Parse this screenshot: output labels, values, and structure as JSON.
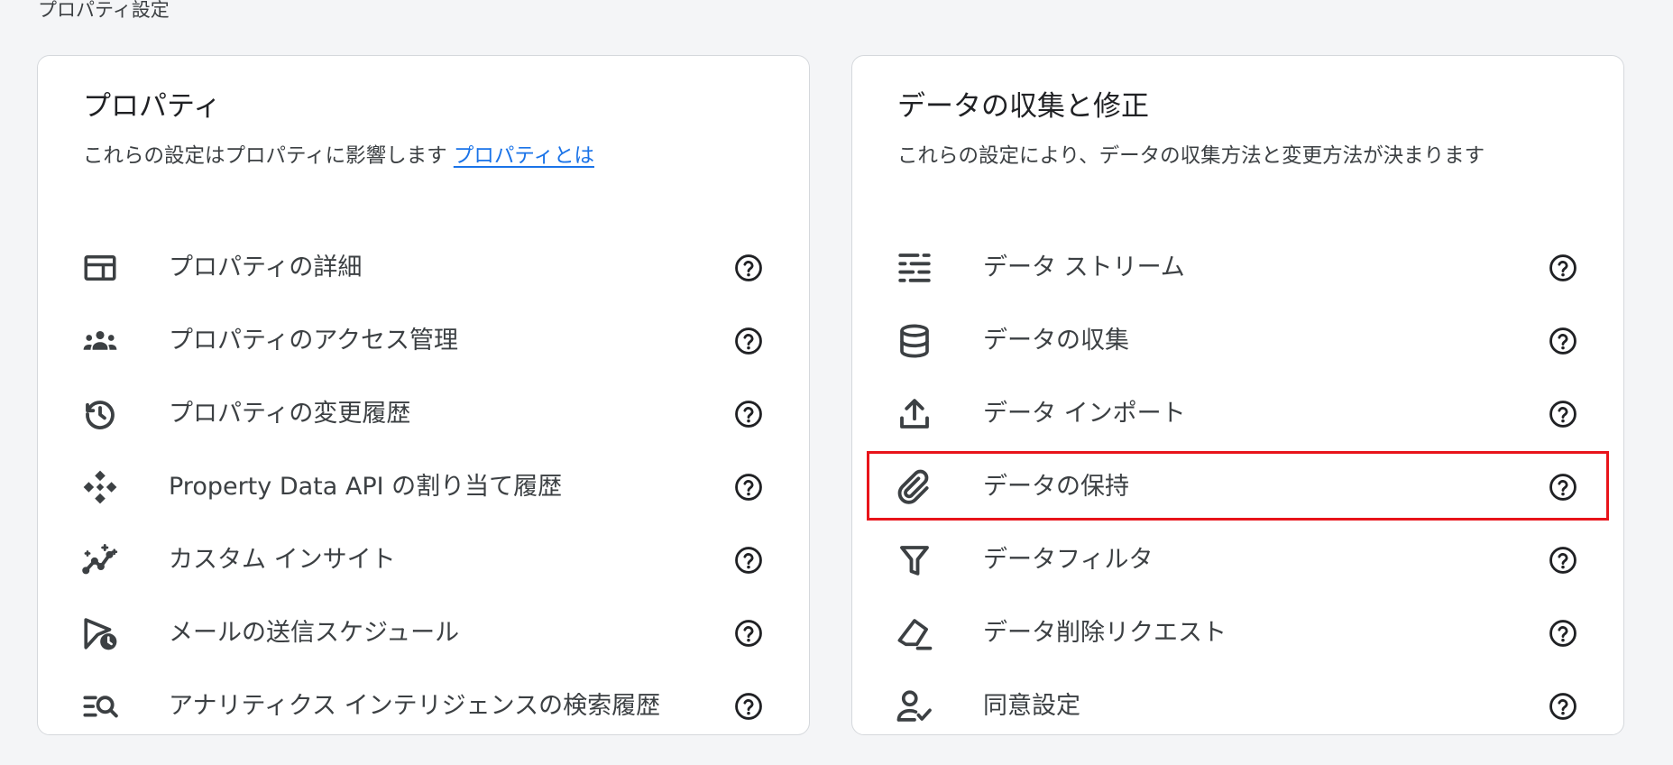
{
  "page_title": "プロパティ設定",
  "colors": {
    "link": "#1a73e8",
    "highlight": "#e8141a",
    "icon": "#3c4043"
  },
  "property_card": {
    "title": "プロパティ",
    "description": "これらの設定はプロパティに影響します",
    "link_text": "プロパティとは",
    "items": [
      {
        "label": "プロパティの詳細",
        "icon": "web-layout-icon"
      },
      {
        "label": "プロパティのアクセス管理",
        "icon": "group-icon"
      },
      {
        "label": "プロパティの変更履歴",
        "icon": "history-icon"
      },
      {
        "label": "Property Data API の割り当て履歴",
        "icon": "api-icon"
      },
      {
        "label": "カスタム インサイト",
        "icon": "insights-icon"
      },
      {
        "label": "メールの送信スケジュール",
        "icon": "scheduled-send-icon"
      },
      {
        "label": "アナリティクス インテリジェンスの検索履歴",
        "icon": "manage-search-icon"
      }
    ]
  },
  "data_card": {
    "title": "データの収集と修正",
    "description": "これらの設定により、データの収集方法と変更方法が決まります",
    "items": [
      {
        "label": "データ ストリーム",
        "icon": "data-streams-icon"
      },
      {
        "label": "データの収集",
        "icon": "database-icon"
      },
      {
        "label": "データ インポート",
        "icon": "upload-icon"
      },
      {
        "label": "データの保持",
        "icon": "attachment-icon",
        "highlighted": true
      },
      {
        "label": "データフィルタ",
        "icon": "filter-icon"
      },
      {
        "label": "データ削除リクエスト",
        "icon": "eraser-icon"
      },
      {
        "label": "同意設定",
        "icon": "consent-person-icon"
      }
    ]
  },
  "help_icon": "help-circle-icon"
}
